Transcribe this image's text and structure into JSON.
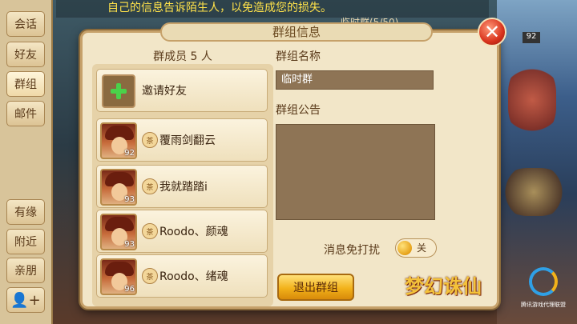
{
  "notice": "自己的信息告诉陌生人，以免造成您的损失。",
  "side_menu": [
    {
      "label": "会话"
    },
    {
      "label": "好友"
    },
    {
      "label": "群组"
    },
    {
      "label": "邮件"
    },
    {
      "label": "有缘"
    },
    {
      "label": "附近"
    },
    {
      "label": "亲朋"
    }
  ],
  "dialog": {
    "title": "群组信息",
    "close_symbol": "✕",
    "members_title": "群成员 5 人",
    "invite_label": "邀请好友",
    "members": [
      {
        "name": "覆雨剑翻云",
        "level": "92",
        "badge": "茶"
      },
      {
        "name": "我就踏踏i",
        "level": "93",
        "badge": "茶"
      },
      {
        "name": "Roodo、颜魂",
        "level": "93",
        "badge": "茶"
      },
      {
        "name": "Roodo、绪魂",
        "level": "96",
        "badge": "茶"
      }
    ],
    "group_name_label": "群组名称",
    "group_name_value": "临时群",
    "group_notice_label": "群组公告",
    "do_not_disturb_label": "消息免打扰",
    "do_not_disturb_state": "关",
    "exit_button": "退出群组"
  },
  "background": {
    "tab_partial": "临时群(5/50)",
    "level_partial": "92"
  },
  "logos": {
    "game_title": "梦幻诛仙",
    "publisher": "腾讯游戏代理联盟"
  },
  "colors": {
    "notice_text": "#ffe24a",
    "accent_gold": "#f2b21a",
    "invite_plus": "#4ad24a",
    "close_red": "#d8321c"
  }
}
